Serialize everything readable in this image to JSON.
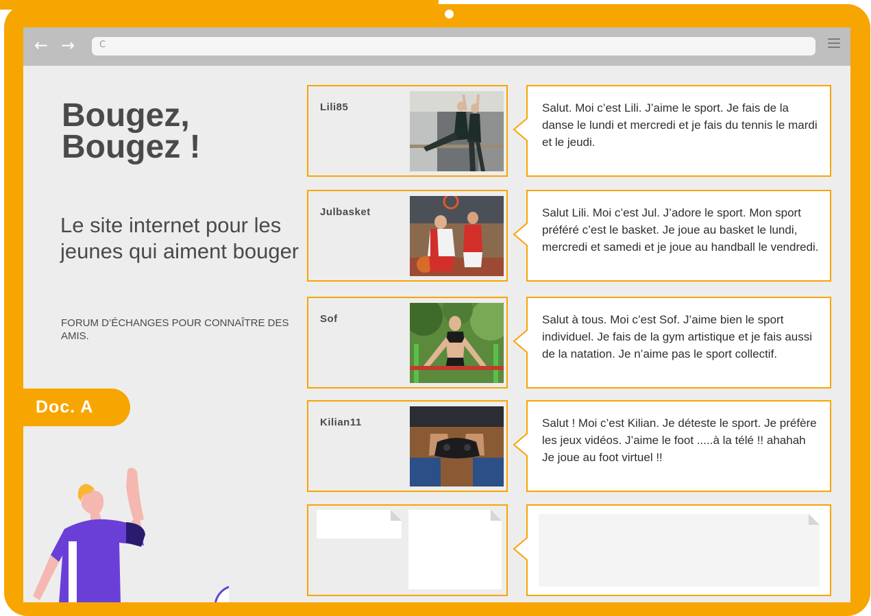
{
  "browser": {
    "back_icon": "←",
    "forward_icon": "→",
    "reload_icon": "C",
    "menu_icon": "hamburger-menu-icon"
  },
  "hero": {
    "title": "Bougez, Bougez !",
    "subtitle": "Le site internet pour les jeunes qui aiment bouger",
    "tagline": "FORUM D’ÉCHANGES POUR CONNAÎTRE DES AMIS."
  },
  "badge": {
    "label": "Doc. A"
  },
  "posts": [
    {
      "username": "Lili85",
      "photo": "ballet-dancers-photo",
      "message": "Salut. Moi c’est Lili. J’aime le sport. Je fais de la danse le lundi et mercredi et je fais du tennis le mardi et le jeudi."
    },
    {
      "username": "Julbasket",
      "photo": "basketball-players-photo",
      "message": "Salut Lili. Moi c’est Jul. J’adore le sport. Mon sport préféré c’est le basket. Je joue au basket le lundi, mercredi et samedi et je joue au handball le vendredi."
    },
    {
      "username": "Sof",
      "photo": "gymnast-athlete-photo",
      "message": "Salut à tous. Moi c’est Sof. J’aime bien le sport individuel. Je fais de la gym artistique et je fais aussi de la natation. Je n’aime pas le sport collectif."
    },
    {
      "username": "Kilian11",
      "photo": "game-controller-photo",
      "message": "Salut ! Moi c’est Kilian. Je déteste le sport. Je préfère les jeux vidéos. J’aime le foot .....à la télé !! ahahah Je joue au foot virtuel !!"
    }
  ],
  "colors": {
    "frame": "#f7a500",
    "screen": "#ededed",
    "text": "#4a4a4a",
    "character_shirt": "#6a3fd8"
  }
}
